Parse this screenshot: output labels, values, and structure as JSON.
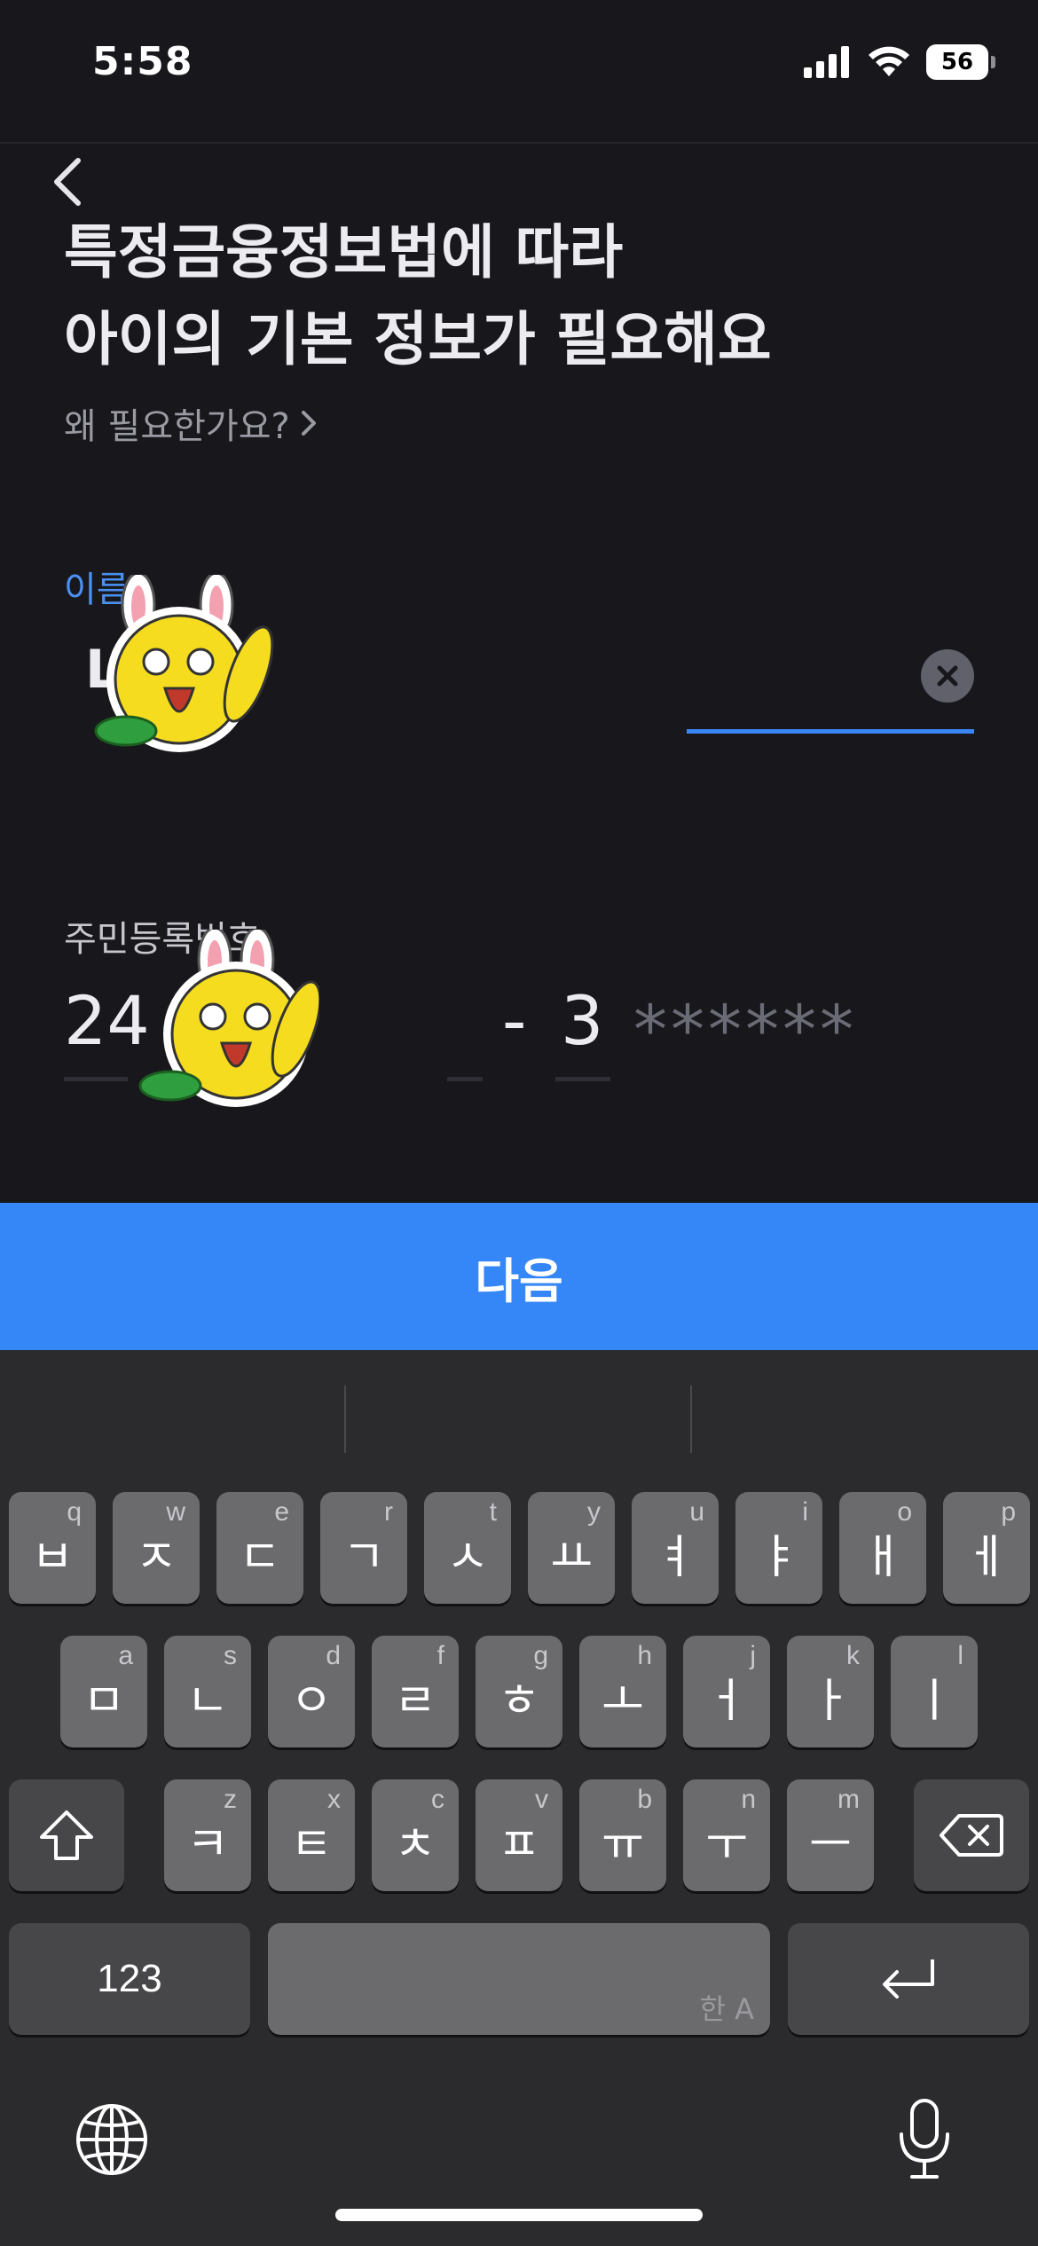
{
  "status_bar": {
    "time": "5:58",
    "battery": "56"
  },
  "header": {
    "title_line1": "특정금융정보법에 따라",
    "title_line2": "아이의 기본 정보가 필요해요",
    "why_link": "왜 필요한가요?"
  },
  "form": {
    "name_label": "이름",
    "name_value": "L",
    "rrn_label": "주민등록번호",
    "rrn_front_visible": "24",
    "rrn_dash": "-",
    "rrn_back_first": "3",
    "rrn_back_mask": "******"
  },
  "next_button": "다음",
  "keyboard": {
    "row1": [
      {
        "ch": "ㅂ",
        "hint": "q"
      },
      {
        "ch": "ㅈ",
        "hint": "w"
      },
      {
        "ch": "ㄷ",
        "hint": "e"
      },
      {
        "ch": "ㄱ",
        "hint": "r"
      },
      {
        "ch": "ㅅ",
        "hint": "t"
      },
      {
        "ch": "ㅛ",
        "hint": "y"
      },
      {
        "ch": "ㅕ",
        "hint": "u"
      },
      {
        "ch": "ㅑ",
        "hint": "i"
      },
      {
        "ch": "ㅐ",
        "hint": "o"
      },
      {
        "ch": "ㅔ",
        "hint": "p"
      }
    ],
    "row2": [
      {
        "ch": "ㅁ",
        "hint": "a"
      },
      {
        "ch": "ㄴ",
        "hint": "s"
      },
      {
        "ch": "ㅇ",
        "hint": "d"
      },
      {
        "ch": "ㄹ",
        "hint": "f"
      },
      {
        "ch": "ㅎ",
        "hint": "g"
      },
      {
        "ch": "ㅗ",
        "hint": "h"
      },
      {
        "ch": "ㅓ",
        "hint": "j"
      },
      {
        "ch": "ㅏ",
        "hint": "k"
      },
      {
        "ch": "ㅣ",
        "hint": "l"
      }
    ],
    "row3": [
      {
        "ch": "ㅋ",
        "hint": "z"
      },
      {
        "ch": "ㅌ",
        "hint": "x"
      },
      {
        "ch": "ㅊ",
        "hint": "c"
      },
      {
        "ch": "ㅍ",
        "hint": "v"
      },
      {
        "ch": "ㅠ",
        "hint": "b"
      },
      {
        "ch": "ㅜ",
        "hint": "n"
      },
      {
        "ch": "ㅡ",
        "hint": "m"
      }
    ],
    "numbers_key": "123",
    "space_hint": "한 A",
    "icons": {
      "shift": "shift-icon",
      "delete": "delete-icon",
      "return": "return-icon",
      "globe": "globe-icon",
      "mic": "microphone-icon"
    }
  },
  "colors": {
    "accent": "#3586f6",
    "background": "#17171c",
    "keyboard": "#2b2b2e"
  }
}
